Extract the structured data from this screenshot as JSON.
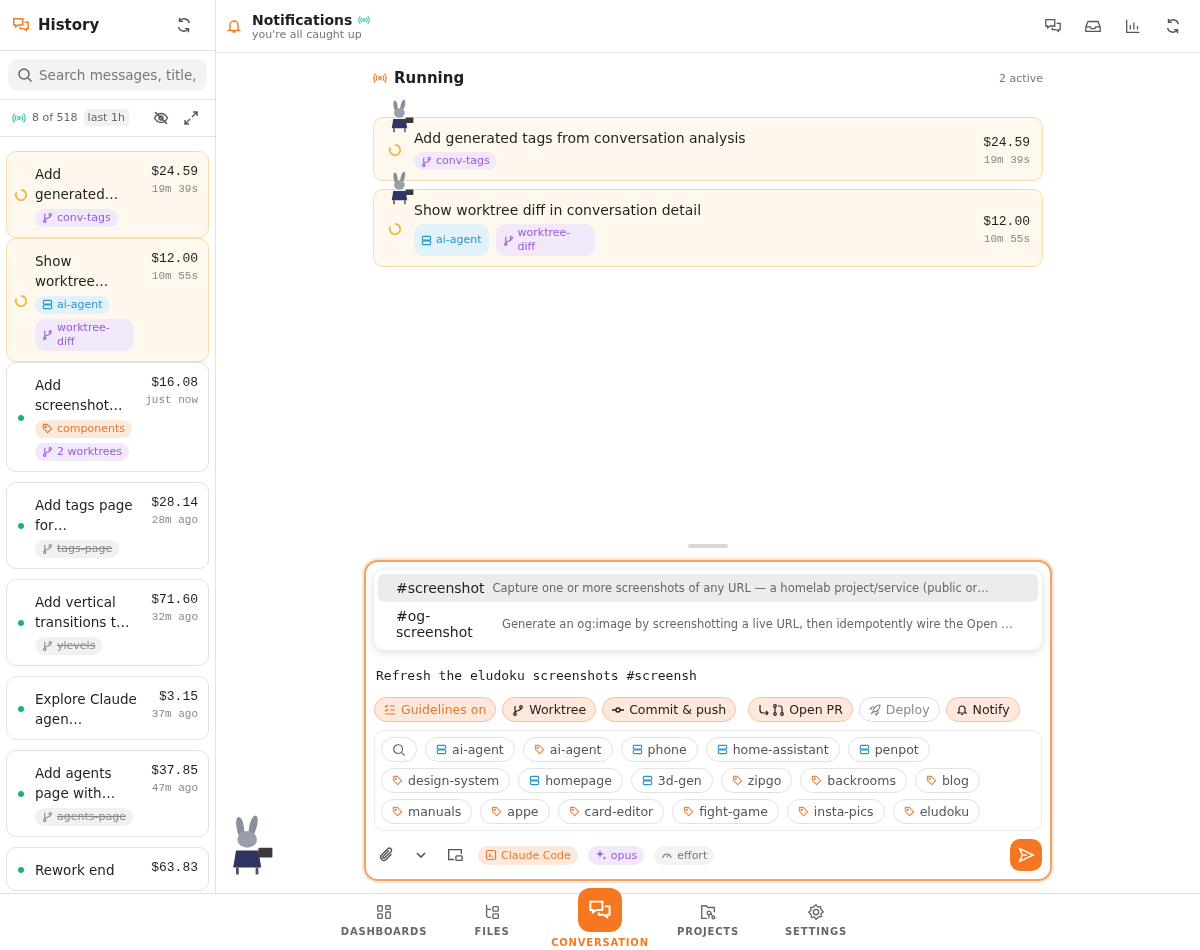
{
  "sidebar": {
    "title": "History",
    "search": {
      "placeholder": "Search messages, title,"
    },
    "count": "8 of 518",
    "filter": "last 1h",
    "conversations": [
      {
        "title": "Add generated…",
        "cost": "$24.59",
        "time": "19m 39s",
        "running": true,
        "tags": [
          {
            "kind": "branch",
            "label": "conv-tags",
            "merged": false
          }
        ]
      },
      {
        "title": "Show worktree…",
        "cost": "$12.00",
        "time": "10m 55s",
        "running": true,
        "tags": [
          {
            "kind": "project",
            "label": "ai-agent",
            "merged": false
          },
          {
            "kind": "branch",
            "label": "worktree-diff",
            "merged": false
          }
        ]
      },
      {
        "title": "Add screenshot…",
        "cost": "$16.08",
        "time": "just now",
        "running": false,
        "tags": [
          {
            "kind": "label",
            "label": "components",
            "merged": false
          },
          {
            "kind": "branch",
            "label": "2 worktrees",
            "merged": false
          }
        ]
      },
      {
        "title": "Add tags page for…",
        "cost": "$28.14",
        "time": "28m ago",
        "running": false,
        "tags": [
          {
            "kind": "branch",
            "label": "tags-page",
            "merged": true
          }
        ]
      },
      {
        "title": "Add vertical transitions t…",
        "cost": "$71.60",
        "time": "32m ago",
        "running": false,
        "tags": [
          {
            "kind": "branch",
            "label": "ylevels",
            "merged": true
          }
        ]
      },
      {
        "title": "Explore Claude agen…",
        "cost": "$3.15",
        "time": "37m ago",
        "running": false
      },
      {
        "title": "Add agents page with…",
        "cost": "$37.85",
        "time": "47m ago",
        "running": false,
        "tags": [
          {
            "kind": "branch",
            "label": "agents-page",
            "merged": true
          }
        ]
      },
      {
        "title": "Rework end",
        "cost": "$63.83",
        "running": false
      }
    ]
  },
  "header": {
    "title": "Notifications",
    "subtitle": "you're all caught up"
  },
  "running": {
    "title": "Running",
    "count": "2 active",
    "items": [
      {
        "title": "Add generated tags from conversation analysis",
        "cost": "$24.59",
        "time": "19m 39s",
        "tags": [
          {
            "kind": "branch",
            "label": "conv-tags",
            "merged": false
          }
        ]
      },
      {
        "title": "Show worktree diff in conversation detail",
        "cost": "$12.00",
        "time": "10m 55s",
        "tags": [
          {
            "kind": "project",
            "label": "ai-agent",
            "merged": false
          },
          {
            "kind": "branch",
            "label": "worktree-diff",
            "merged": false
          }
        ]
      }
    ]
  },
  "composer": {
    "suggestions": [
      {
        "tag": "#screenshot",
        "description": "Capture one or more screenshots of any URL — a homelab project/service (public or…",
        "selected": true
      },
      {
        "tag": "#og-screenshot",
        "description": "Generate an og:image by screenshotting a live URL, then idempotently wire the Open …",
        "selected": false
      }
    ],
    "value": "Refresh the eludoku screenshots #screensh",
    "toggles": [
      {
        "kind": "guidelines",
        "label": "Guidelines on",
        "on": true
      },
      {
        "kind": "worktree",
        "label": "Worktree",
        "on": true
      },
      {
        "kind": "commit",
        "label": "Commit & push",
        "on": true
      },
      {
        "kind": "pr",
        "label": "Open PR",
        "on": true
      },
      {
        "kind": "deploy",
        "label": "Deploy",
        "on": false
      },
      {
        "kind": "notify",
        "label": "Notify",
        "on": true
      }
    ],
    "chips": [
      {
        "kind": "project",
        "label": "ai-agent"
      },
      {
        "kind": "label",
        "label": "ai-agent"
      },
      {
        "kind": "project",
        "label": "phone"
      },
      {
        "kind": "project",
        "label": "home-assistant"
      },
      {
        "kind": "project",
        "label": "penpot"
      },
      {
        "kind": "label",
        "label": "design-system"
      },
      {
        "kind": "project",
        "label": "homepage"
      },
      {
        "kind": "project",
        "label": "3d-gen"
      },
      {
        "kind": "label",
        "label": "zipgo"
      },
      {
        "kind": "label",
        "label": "backrooms"
      },
      {
        "kind": "label",
        "label": "blog"
      },
      {
        "kind": "label",
        "label": "manuals"
      },
      {
        "kind": "label",
        "label": "appe"
      },
      {
        "kind": "label",
        "label": "card-editor"
      },
      {
        "kind": "label",
        "label": "fight-game"
      },
      {
        "kind": "label",
        "label": "insta-pics"
      },
      {
        "kind": "label",
        "label": "eludoku"
      }
    ],
    "options": [
      {
        "kind": "agent",
        "label": "Claude Code"
      },
      {
        "kind": "model",
        "label": "opus"
      },
      {
        "kind": "effort",
        "label": "effort"
      }
    ]
  },
  "nav": [
    {
      "kind": "dashboards",
      "label": "DASHBOARDS",
      "selected": false
    },
    {
      "kind": "files",
      "label": "FILES",
      "selected": false
    },
    {
      "kind": "conversation",
      "label": "CONVERSATION",
      "selected": true
    },
    {
      "kind": "projects",
      "label": "PROJECTS",
      "selected": false
    },
    {
      "kind": "settings",
      "label": "SETTINGS",
      "selected": false
    }
  ]
}
